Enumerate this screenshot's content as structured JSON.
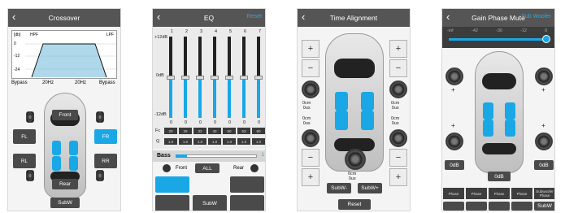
{
  "colors": {
    "accent": "#1aa7e6",
    "header": "#555555",
    "button_dark": "#4a4a4a"
  },
  "crossover": {
    "title": "Crossover",
    "graph": {
      "db_label": "[db]",
      "hpf": "HPF",
      "lpf": "LPF",
      "y_ticks": [
        "0",
        "-12",
        "-24"
      ]
    },
    "hpf_left": "Bypass",
    "hpf_right": "20Hz",
    "lpf_left": "20Hz",
    "lpf_right": "Bypass",
    "speakers": {
      "front": "Front",
      "fl": "FL",
      "fr": "FR",
      "rl": "RL",
      "rr": "RR",
      "rear": "Rear",
      "subw": "SubW"
    }
  },
  "eq": {
    "title": "EQ",
    "reset": "Reset",
    "band_numbers": [
      "1",
      "2",
      "3",
      "4",
      "5",
      "6",
      "7"
    ],
    "scale": {
      "top": "+12dB",
      "mid": "0dB",
      "bottom": "-12dB"
    },
    "gains": [
      "0",
      "0",
      "0",
      "0",
      "0",
      "0",
      "0"
    ],
    "fc_label": "Fc",
    "q_label": "Q",
    "fc_values": [
      "20",
      "29",
      "32",
      "40",
      "50",
      "63",
      "80"
    ],
    "q_values": [
      "1.0",
      "1.0",
      "1.0",
      "1.0",
      "1.0",
      "1.0",
      "1.0"
    ],
    "bass_label": "Bass",
    "bass_value": "1",
    "front": "Front",
    "all": "ALL",
    "rear": "Rear",
    "subw": "SubW"
  },
  "time_alignment": {
    "title": "Time Alignment",
    "plus": "+",
    "minus": "−",
    "delay_fl": "0cm\n0us",
    "delay_fr": "0cm\n0us",
    "delay_rl": "0cm\n0us",
    "delay_rr": "0cm\n0us",
    "delay_sub": "0cm\n0us",
    "subw_minus": "SubW-",
    "subw_plus": "SubW+",
    "reset": "Reset"
  },
  "gain_phase": {
    "title": "Gain Phase Mute",
    "right_link": "Sub Woofer",
    "scale": [
      "-inf",
      "-42",
      "-30",
      "-12",
      "0"
    ],
    "gains": [
      "0dB",
      "0dB",
      "0dB",
      "0dB"
    ],
    "sub_gain": "0dB",
    "phase_labels": [
      "Phase",
      "Phase",
      "Phase",
      "Phase",
      "Subwoofer\nPhase"
    ],
    "subw": "SubW"
  }
}
